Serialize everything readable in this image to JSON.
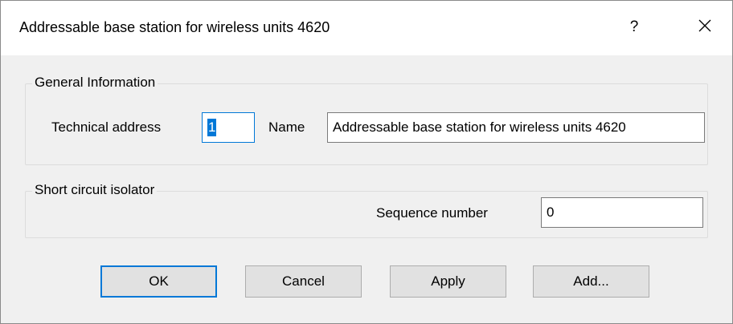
{
  "window": {
    "title": "Addressable base station for wireless units 4620",
    "help_label": "?",
    "close_icon": "close-icon"
  },
  "general_information": {
    "group_label": "General Information",
    "technical_address_label": "Technical address",
    "technical_address_value": "1",
    "name_label": "Name",
    "name_value": "Addressable base station for wireless units 4620"
  },
  "short_circuit_isolator": {
    "group_label": "Short circuit isolator",
    "sequence_number_label": "Sequence number",
    "sequence_number_value": "0"
  },
  "buttons": {
    "ok_label": "OK",
    "cancel_label": "Cancel",
    "apply_label": "Apply",
    "add_label": "Add..."
  },
  "colors": {
    "focus_accent": "#0078d7",
    "dialog_background": "#f0f0f0",
    "titlebar_background": "#ffffff"
  }
}
